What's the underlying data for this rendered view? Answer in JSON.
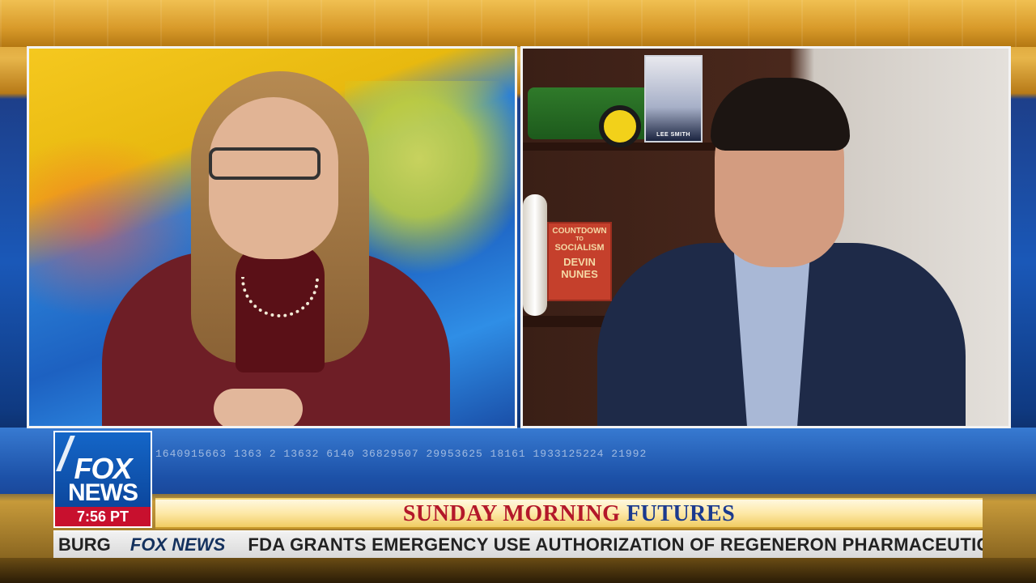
{
  "logo": {
    "fox": "FOX",
    "news": "NEWS",
    "time": "7:56 PT"
  },
  "ticker_numbers": "1640915663 1363 2 13632 6140 36829507 29953625 18161 1933125224 21992",
  "show": {
    "word1": "SUNDAY",
    "word2": "MORNING",
    "word3": "FUTURES"
  },
  "crawl": {
    "prefix": "BURG",
    "brand": "FOX NEWS",
    "headline": "FDA GRANTS EMERGENCY USE AUTHORIZATION OF REGENERON PHARMACEUTICAL"
  },
  "book_red": {
    "line1": "COUNTDOWN",
    "line2": "TO",
    "line3": "SOCIALISM",
    "line4": "DEVIN",
    "line5": "NUNES"
  },
  "book_trump": {
    "label": "LEE SMITH"
  },
  "colors": {
    "fox_blue": "#0a3f92",
    "fox_red": "#c8102e",
    "show_red": "#b3182a",
    "show_blue": "#1b3a8e"
  }
}
